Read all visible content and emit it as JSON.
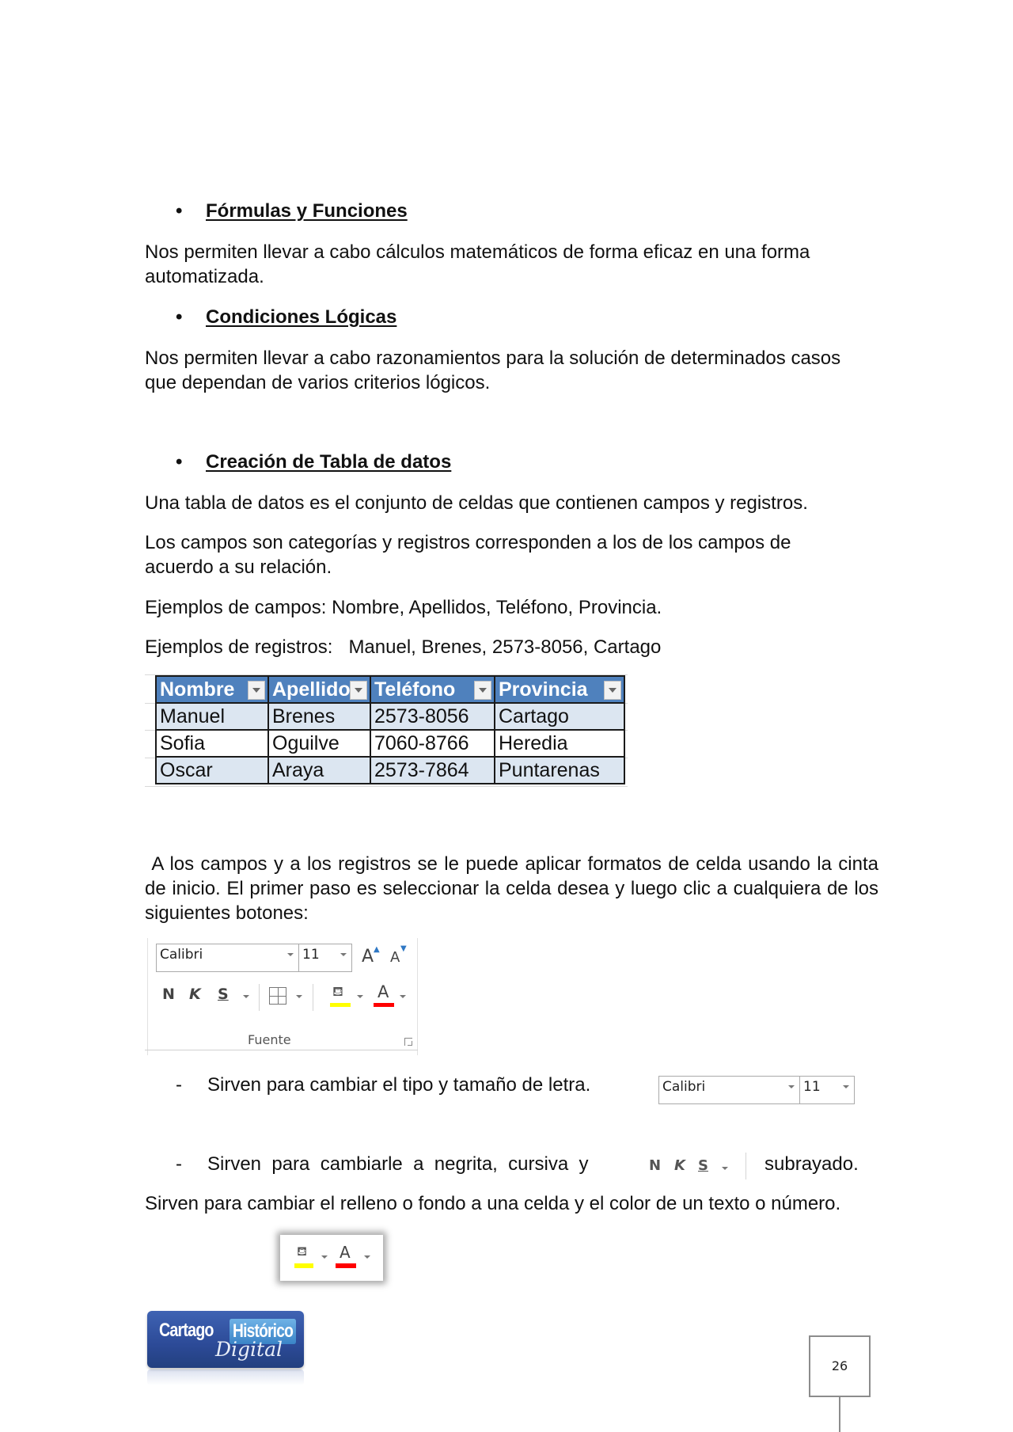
{
  "sections": {
    "formulas": {
      "heading": "Fórmulas y Funciones",
      "body": "Nos permiten llevar a cabo cálculos matemáticos de forma eficaz en una forma automatizada."
    },
    "conditions": {
      "heading": "Condiciones Lógicas",
      "body": "Nos permiten llevar a cabo razonamientos para la solución de determinados casos que dependan de varios criterios lógicos."
    },
    "table_creation": {
      "heading": "Creación de Tabla de datos",
      "p1": "Una tabla de datos es el conjunto de celdas que contienen campos y registros.",
      "p2": "Los campos son categorías y registros corresponden a los de los campos de acuerdo a su relación.",
      "p3": "Ejemplos de campos: Nombre, Apellidos, Teléfono, Provincia.",
      "p4": "Ejemplos de registros:   Manuel, Brenes, 2573-8056, Cartago"
    }
  },
  "bullet_symbol": "•",
  "dash_symbol": "-",
  "data_table": {
    "headers": [
      "Nombre",
      "Apellido",
      "Teléfono",
      "Provincia"
    ],
    "rows": [
      [
        "Manuel",
        "Brenes",
        "2573-8056",
        "Cartago"
      ],
      [
        "Sofia",
        "Oguilve",
        "7060-8766",
        "Heredia"
      ],
      [
        "Oscar",
        "Araya",
        "2573-7864",
        "Puntarenas"
      ]
    ],
    "colors": {
      "header": "#4f81bd",
      "band": "#dce6f1"
    }
  },
  "format_intro": " A los campos y a los registros se le puede aplicar formatos de celda usando la cinta de inicio. El primer paso es seleccionar la celda desea y luego clic a cualquiera de los siguientes botones:",
  "ribbon": {
    "font_name": "Calibri",
    "font_size": "11",
    "grow_font": "A",
    "shrink_font": "A",
    "bold": "N",
    "italic": "K",
    "underline": "S",
    "group_label": "Fuente",
    "fill_color": "#ffff00",
    "font_color": "#ff0000",
    "font_color_letter": "A"
  },
  "items": {
    "font_type": "Sirven para cambiar el tipo y tamaño de letra.",
    "bold_italic_pre": "Sirven  para  cambiarle  a  negrita,  cursiva  y",
    "bold_italic_post": "subrayado.",
    "fill_color": "Sirven para cambiar el relleno o fondo a una celda y el color de un texto o número."
  },
  "footer": {
    "logo_main": "Cartago",
    "logo_highlight": "Histórico",
    "logo_script": "Digital",
    "page_number": "26"
  }
}
